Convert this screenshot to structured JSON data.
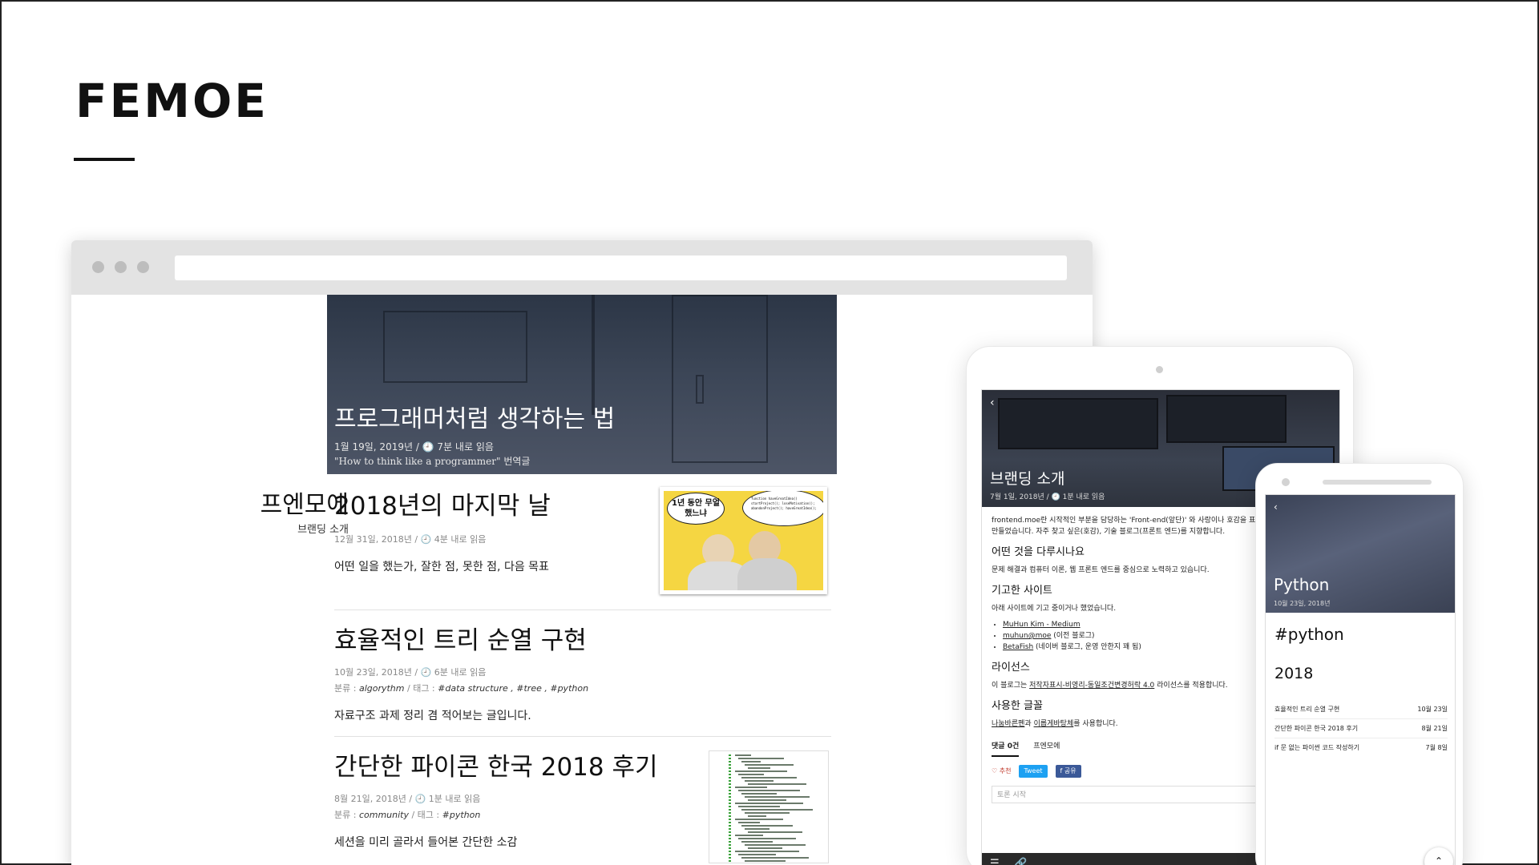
{
  "brand": {
    "title": "FEMOE"
  },
  "desktop": {
    "sidebar": {
      "name": "프엔모에",
      "link": "브랜딩 소개"
    },
    "hero_post": {
      "title": "프로그래머처럼 생각하는 법",
      "meta": "1월 19일, 2019년 / 🕘 7분 내로 읽음",
      "subtitle": "\"How to think like a programmer\" 번역글"
    },
    "posts": [
      {
        "title": "2018년의 마지막 날",
        "meta": "12월 31일, 2018년 / 🕘 4분 내로 읽음",
        "excerpt": "어떤 일을 했는가, 잘한 점, 못한 점, 다음 목표",
        "thumb_bubbles": [
          "1년 동안 무얼 했느냐",
          "function haveGreatIdea() startProject(); loseMotivation(); abandonProject(); haveGreatIdea();"
        ]
      },
      {
        "title": "효율적인 트리 순열 구현",
        "meta": "10월 23일, 2018년 / 🕘 6분 내로 읽음",
        "cats_prefix": "분류 : ",
        "category": "algorythm",
        "tags_prefix": " / 태그 : ",
        "tags": "#data structure , #tree , #python",
        "excerpt": "자료구조 과제 정리 겸 적어보는 글입니다."
      },
      {
        "title": "간단한 파이콘 한국 2018 후기",
        "meta": "8월 21일, 2018년 / 🕘 1분 내로 읽음",
        "cats_prefix": "분류 : ",
        "category": "community",
        "tags_prefix": " / 태그 : ",
        "tags": "#python",
        "excerpt": "세션을 미리 골라서 들어본 간단한 소감"
      }
    ]
  },
  "tablet": {
    "back": "‹",
    "title": "브랜딩 소개",
    "date": "7월 1일, 2018년 / 🕘 1분 내로 읽음",
    "intro": "frontend.moe란 시작적인 부분을 담당하는 'Front-end(앞단)' 와 사랑이나 호감을 표현하는 '모에' 를 조합해서 만들었습니다. 자주 찾고 싶은(호감), 기술 블로그(프론트 엔드)를 지향합니다.",
    "sections": [
      {
        "heading": "어떤 것을 다루시나요",
        "text": "문제 해결과 컴퓨터 이론, 웹 프론트 엔드를 중심으로 노력하고 있습니다."
      },
      {
        "heading": "기고한 사이트",
        "text": "아래 사이트에 기고 중이거나 했었습니다."
      }
    ],
    "sites": [
      {
        "name": "MuHun Kim - Medium",
        "note": ""
      },
      {
        "name": "muhun@moe",
        "note": " (이전 블로그)"
      },
      {
        "name": "BetaFish",
        "note": " (네이버 블로그, 운영 안한지 꽤 됨)"
      }
    ],
    "license": {
      "heading": "라이선스",
      "prefix": "이 블로그는 ",
      "name": "저작자표시-비영리-동일조건변경허락 4.0",
      "suffix": " 라이선스를 적용합니다."
    },
    "fonts": {
      "heading": "사용한 글꼴",
      "f1": "나눔바른펜",
      "mid": "과 ",
      "f2": "이롭게바탕체",
      "suffix": "를 사용합니다."
    },
    "tabs": [
      "댓글 0건",
      "프엔모에"
    ],
    "actions": {
      "like": "♡ 추천",
      "tweet": "Tweet",
      "share": "f 공유"
    },
    "comment_placeholder": "토론 시작",
    "bottom_icons": [
      "☰",
      "🔗"
    ]
  },
  "phone": {
    "back": "‹",
    "title": "Python",
    "date": "10월 23일, 2018년",
    "tag": "#python",
    "year": "2018",
    "posts": [
      {
        "title": "효율적인 트리 순열 구현",
        "date": "10월 23일"
      },
      {
        "title": "간단한 파이콘 한국 2018 후기",
        "date": "8월 21일"
      },
      {
        "title": "if 문 없는 파이썬 코드 작성하기",
        "date": "7월 8일"
      }
    ],
    "up": "⌃"
  },
  "colors": {
    "tweet": "#1da1f2",
    "facebook": "#3b5998",
    "comic_bg": "#f5d642"
  }
}
